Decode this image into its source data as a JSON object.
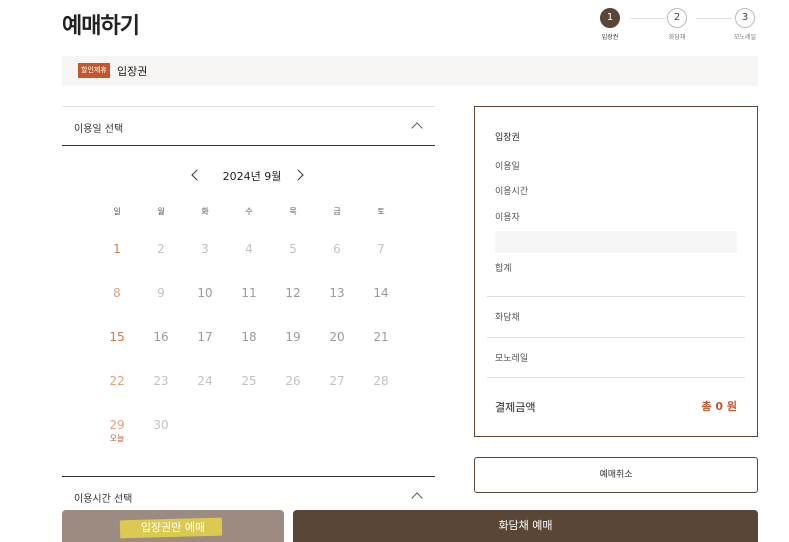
{
  "page": {
    "title": "예매하기"
  },
  "steps": [
    {
      "num": "1",
      "label": "입장권",
      "active": true
    },
    {
      "num": "2",
      "label": "화담채",
      "active": false
    },
    {
      "num": "3",
      "label": "모노레일",
      "active": false
    }
  ],
  "ticket": {
    "badge": "할인제휴",
    "name": "입장권"
  },
  "date_section": {
    "title": "이용일 선택"
  },
  "calendar": {
    "month_label": "2024년 9월",
    "weekdays": [
      "일",
      "월",
      "화",
      "수",
      "목",
      "금",
      "토"
    ],
    "days": [
      "1",
      "2",
      "3",
      "4",
      "5",
      "6",
      "7",
      "8",
      "9",
      "10",
      "11",
      "12",
      "13",
      "14",
      "15",
      "16",
      "17",
      "18",
      "19",
      "20",
      "21",
      "22",
      "23",
      "24",
      "25",
      "26",
      "27",
      "28",
      "29",
      "30"
    ],
    "today_label": "오늘"
  },
  "time_section": {
    "title": "이용시간 선택"
  },
  "summary": {
    "title": "입장권",
    "date_label": "이용일",
    "time_label": "이용시간",
    "user_label": "이용자",
    "total_label": "합계",
    "hwadamchae_label": "화담채",
    "monorail_label": "모노레일",
    "payment_label": "결제금액",
    "payment_value": "총 0 원"
  },
  "buttons": {
    "cancel": "예매취소",
    "ticket_only": "입장권만 예매",
    "hwadamchae": "화담채 예매"
  },
  "colors": {
    "accent": "#c4582a",
    "brand": "#5a4636",
    "muted": "#9b8b80"
  }
}
